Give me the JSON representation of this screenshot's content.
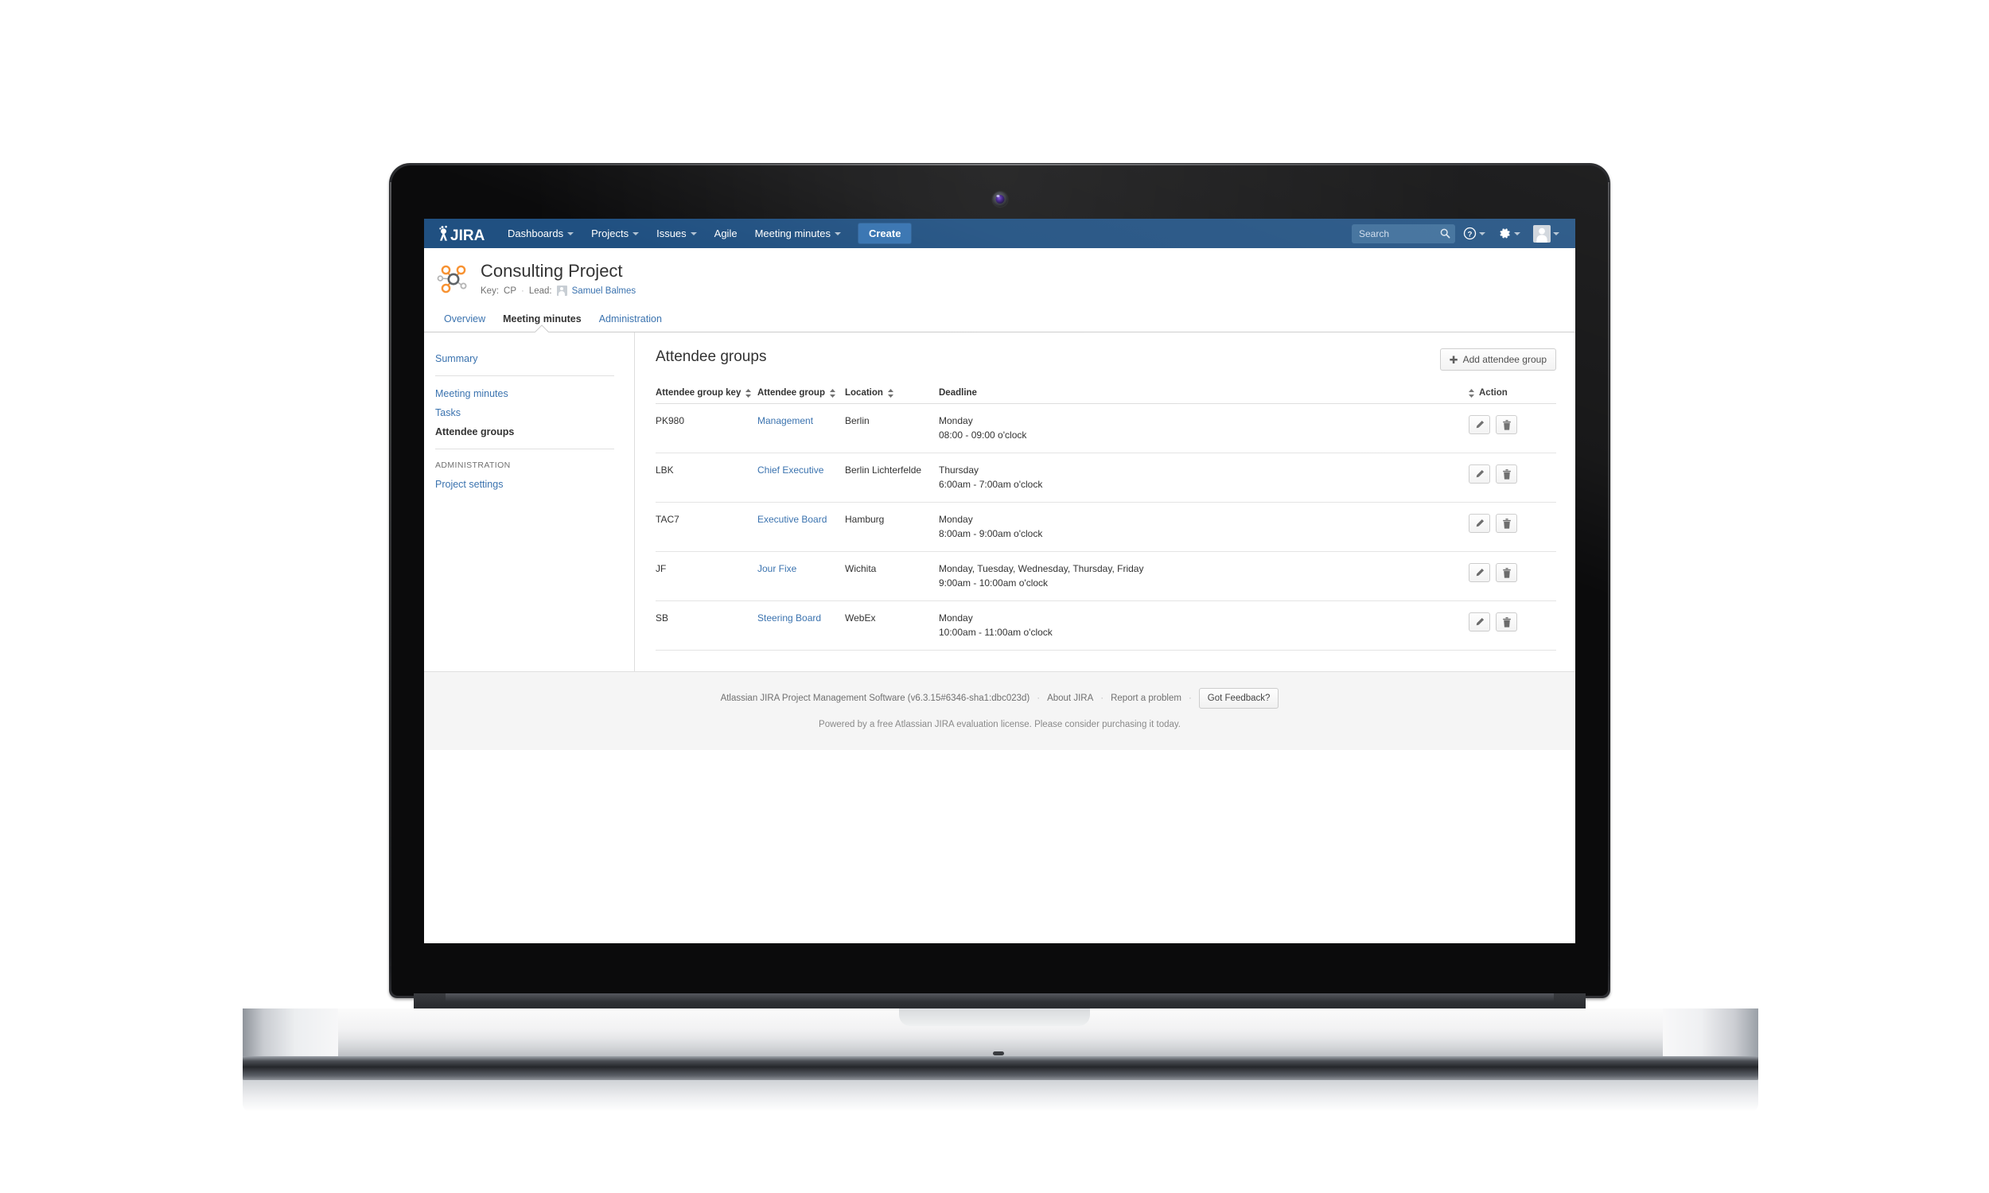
{
  "nav": {
    "logo_text": "JIRA",
    "items": [
      {
        "label": "Dashboards",
        "has_caret": true
      },
      {
        "label": "Projects",
        "has_caret": true
      },
      {
        "label": "Issues",
        "has_caret": true
      },
      {
        "label": "Agile",
        "has_caret": false
      },
      {
        "label": "Meeting minutes",
        "has_caret": true
      }
    ],
    "create_label": "Create",
    "search_placeholder": "Search",
    "search_value": "",
    "icons": [
      "search-icon",
      "help-icon",
      "gear-icon",
      "user-avatar-icon"
    ]
  },
  "project": {
    "title": "Consulting Project",
    "key_label": "Key:",
    "key_value": "CP",
    "separator": "·",
    "lead_label": "Lead:",
    "lead_name": "Samuel Balmes"
  },
  "tabs": [
    {
      "label": "Overview",
      "active": false
    },
    {
      "label": "Meeting minutes",
      "active": true
    },
    {
      "label": "Administration",
      "active": false
    }
  ],
  "sidebar": {
    "group1": [
      {
        "label": "Summary",
        "active": false
      }
    ],
    "group2": [
      {
        "label": "Meeting minutes",
        "active": false
      },
      {
        "label": "Tasks",
        "active": false
      },
      {
        "label": "Attendee groups",
        "active": true
      }
    ],
    "admin_heading": "ADMINISTRATION",
    "group3": [
      {
        "label": "Project settings",
        "active": false
      }
    ]
  },
  "main": {
    "title": "Attendee groups",
    "add_button": "Add attendee group",
    "add_button_icon": "plus-icon",
    "columns": [
      {
        "label": "Attendee group key",
        "sortable": true
      },
      {
        "label": "Attendee group",
        "sortable": true
      },
      {
        "label": "Location",
        "sortable": true
      },
      {
        "label": "Deadline",
        "sortable": true
      },
      {
        "label": "Action",
        "sortable": false
      }
    ],
    "rows": [
      {
        "key": "PK980",
        "group": "Management",
        "location": "Berlin",
        "deadline_days": "Monday",
        "deadline_time": "08:00 - 09:00 o'clock"
      },
      {
        "key": "LBK",
        "group": "Chief Executive",
        "location": "Berlin Lichterfelde",
        "deadline_days": "Thursday",
        "deadline_time": "6:00am - 7:00am o'clock"
      },
      {
        "key": "TAC7",
        "group": "Executive Board",
        "location": "Hamburg",
        "deadline_days": "Monday",
        "deadline_time": "8:00am - 9:00am o'clock"
      },
      {
        "key": "JF",
        "group": "Jour Fixe",
        "location": "Wichita",
        "deadline_days": "Monday, Tuesday, Wednesday, Thursday, Friday",
        "deadline_time": "9:00am - 10:00am o'clock"
      },
      {
        "key": "SB",
        "group": "Steering Board",
        "location": "WebEx",
        "deadline_days": "Monday",
        "deadline_time": "10:00am - 11:00am o'clock"
      }
    ],
    "row_actions": {
      "edit_icon": "pencil-icon",
      "delete_icon": "trash-icon"
    }
  },
  "footer": {
    "product_line": "Atlassian JIRA Project Management Software (v6.3.15#6346-sha1:dbc023d)",
    "about_link": "About JIRA",
    "report_link": "Report a problem",
    "feedback_button": "Got Feedback?",
    "dot": "·",
    "license_line": "Powered by a free Atlassian JIRA evaluation license. Please consider purchasing it today."
  },
  "colors": {
    "nav_blue": "#205081",
    "create_blue": "#3572b0",
    "link_blue": "#3b73af",
    "accent_orange": "#f79232",
    "text_dark": "#333333",
    "muted": "#707070",
    "footer_bg": "#f5f5f5"
  }
}
